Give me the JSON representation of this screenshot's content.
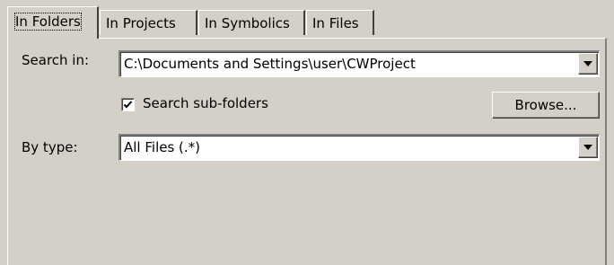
{
  "tabs": [
    {
      "label": "In Folders",
      "active": true
    },
    {
      "label": "In Projects",
      "active": false
    },
    {
      "label": "In Symbolics",
      "active": false
    },
    {
      "label": "In Files",
      "active": false
    }
  ],
  "search_in": {
    "label": "Search in:",
    "value": "C:\\Documents and Settings\\user\\CWProject"
  },
  "search_subfolders": {
    "label": "Search sub-folders",
    "checked": true
  },
  "browse_button": {
    "label": "Browse..."
  },
  "by_type": {
    "label": "By type:",
    "value": "All Files (.*)"
  },
  "colors": {
    "face": "#d4d0c8",
    "highlight": "#ffffff",
    "shadow": "#808080",
    "dark_shadow": "#404040"
  }
}
